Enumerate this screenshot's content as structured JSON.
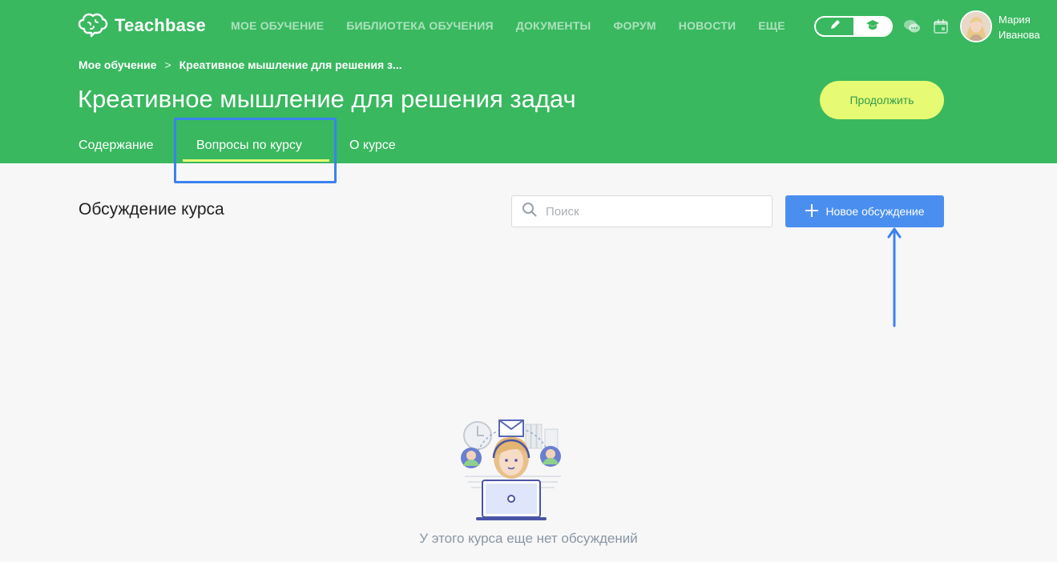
{
  "app": {
    "logo_text": "Teachbase"
  },
  "topnav": [
    {
      "label": "МОЕ ОБУЧЕНИЕ"
    },
    {
      "label": "БИБЛИОТЕКА ОБУЧЕНИЯ"
    },
    {
      "label": "ДОКУМЕНТЫ"
    },
    {
      "label": "ФОРУМ"
    },
    {
      "label": "НОВОСТИ"
    },
    {
      "label": "ЕЩЕ"
    }
  ],
  "user": {
    "first_name": "Мария",
    "last_name": "Иванова"
  },
  "breadcrumb": {
    "root": "Мое обучение",
    "separator": ">",
    "current": "Креативное мышление для решения з..."
  },
  "course": {
    "title": "Креативное мышление для решения задач"
  },
  "continue_button": "Продолжить",
  "tabs": [
    {
      "label": "Содержание"
    },
    {
      "label": "Вопросы по курсу",
      "active": true
    },
    {
      "label": "О курсе"
    }
  ],
  "discussion": {
    "title": "Обсуждение курса",
    "search_placeholder": "Поиск",
    "new_button": "Новое обсуждение",
    "empty_text": "У этого курса еще нет обсуждений"
  },
  "colors": {
    "header_green": "#39b85f",
    "accent_yellow": "#e6fb73",
    "primary_blue": "#4a8ff0",
    "highlight_blue": "#3b82f0"
  }
}
